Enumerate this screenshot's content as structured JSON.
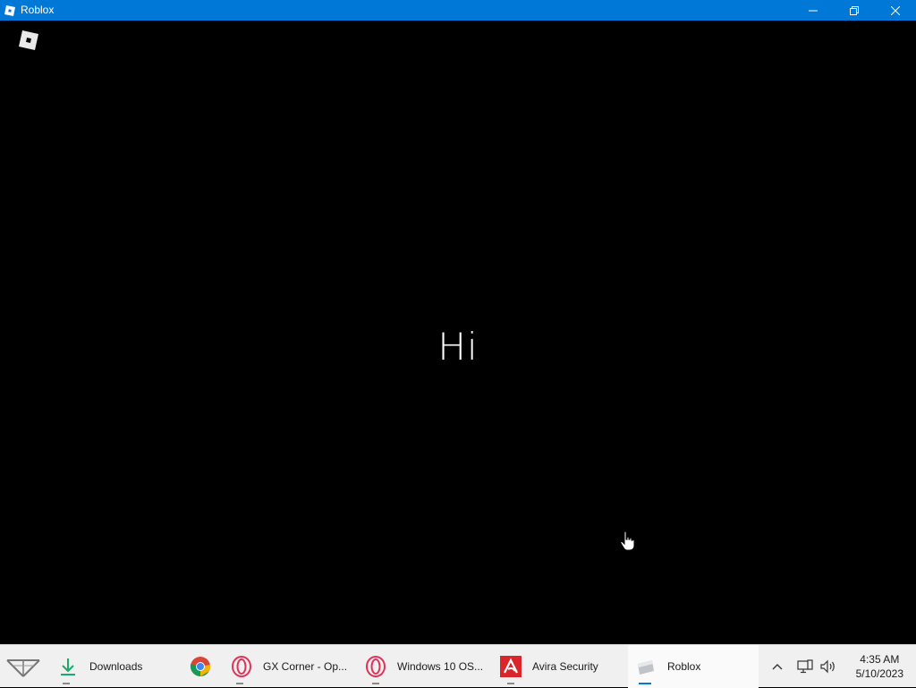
{
  "window": {
    "title": "Roblox"
  },
  "client": {
    "greeting": "Hi"
  },
  "taskbar": {
    "items": [
      {
        "label": "Downloads",
        "icon": "download-arrow-icon"
      },
      {
        "label": "",
        "icon": "chrome-icon"
      },
      {
        "label": "GX Corner - Op...",
        "icon": "opera-gx-icon"
      },
      {
        "label": "Windows 10 OS...",
        "icon": "opera-icon"
      },
      {
        "label": "Avira Security",
        "icon": "avira-icon"
      },
      {
        "label": "Roblox",
        "icon": "roblox-icon"
      }
    ],
    "clock": {
      "time": "4:35 AM",
      "date": "5/10/2023"
    }
  },
  "colors": {
    "titlebar": "#0078d7",
    "background": "#000000",
    "taskbar": "#f0f0f0"
  }
}
